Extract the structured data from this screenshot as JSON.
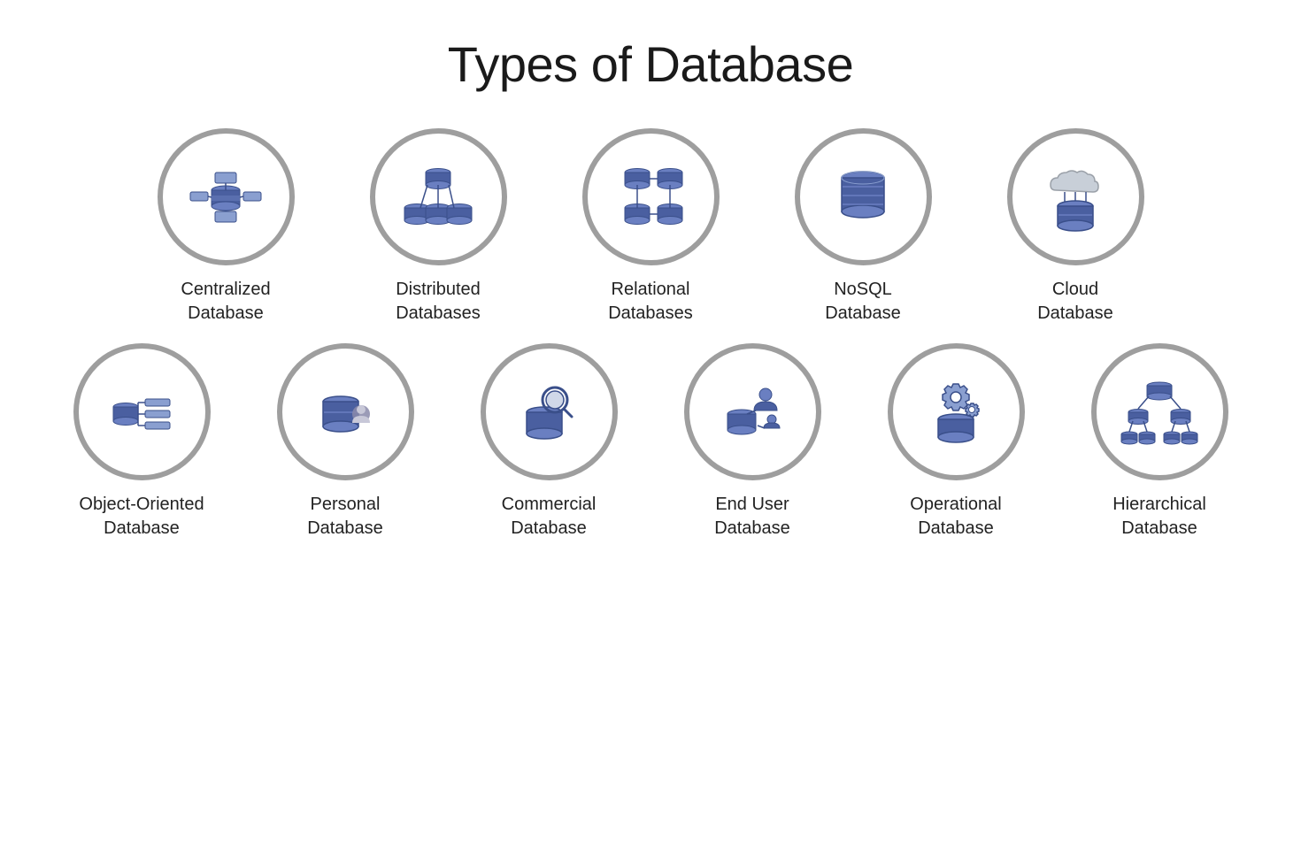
{
  "page": {
    "title": "Types of Database"
  },
  "row1": [
    {
      "id": "centralized",
      "label": "Centralized\nDatabase"
    },
    {
      "id": "distributed",
      "label": "Distributed\nDatabases"
    },
    {
      "id": "relational",
      "label": "Relational\nDatabases"
    },
    {
      "id": "nosql",
      "label": "NoSQL\nDatabase"
    },
    {
      "id": "cloud",
      "label": "Cloud\nDatabase"
    }
  ],
  "row2": [
    {
      "id": "object-oriented",
      "label": "Object-Oriented\nDatabase"
    },
    {
      "id": "personal",
      "label": "Personal\nDatabase"
    },
    {
      "id": "commercial",
      "label": "Commercial\nDatabase"
    },
    {
      "id": "end-user",
      "label": "End User\nDatabase"
    },
    {
      "id": "operational",
      "label": "Operational\nDatabase"
    },
    {
      "id": "hierarchical",
      "label": "Hierarchical\nDatabase"
    }
  ]
}
